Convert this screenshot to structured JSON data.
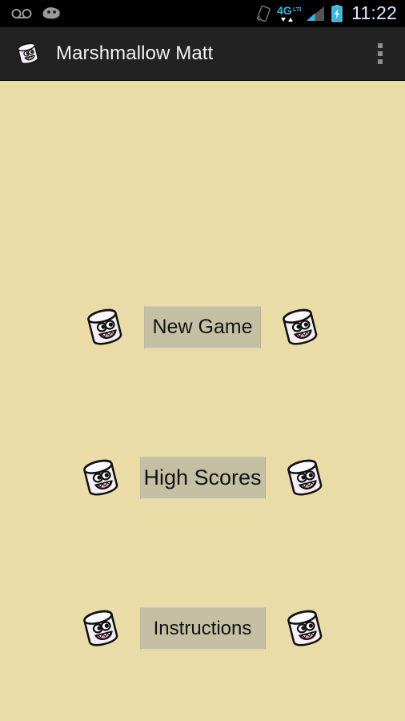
{
  "status_bar": {
    "icons": [
      {
        "name": "voicemail-icon"
      },
      {
        "name": "android-mascot-icon"
      }
    ],
    "right_icons": [
      {
        "name": "rotation-lock-icon"
      },
      {
        "name": "network-4g-icon",
        "label": "4G"
      },
      {
        "name": "signal-bars-icon"
      },
      {
        "name": "battery-charging-icon"
      }
    ],
    "clock": "11:22",
    "background_color": "#000000",
    "clock_color": "#D9EEFB",
    "accent_color": "#34B6E4"
  },
  "action_bar": {
    "app_icon_name": "marshmallow-matt-app-icon",
    "title": "Marshmallow Matt",
    "overflow_label": "More options",
    "background_color": "#222222",
    "title_color": "#F2F2F2"
  },
  "main": {
    "background_color": "#E9DCA6",
    "button_color": "#C5C0A4",
    "button_text_color": "#131313",
    "menu": [
      {
        "id": "new-game",
        "label": "New Game",
        "left_icon_name": "marshmallow-character-icon",
        "right_icon_name": "marshmallow-character-icon"
      },
      {
        "id": "high-scores",
        "label": "High Scores",
        "left_icon_name": "marshmallow-character-icon",
        "right_icon_name": "marshmallow-character-icon"
      },
      {
        "id": "instructions",
        "label": "Instructions",
        "left_icon_name": "marshmallow-character-icon",
        "right_icon_name": "marshmallow-character-icon"
      }
    ]
  }
}
